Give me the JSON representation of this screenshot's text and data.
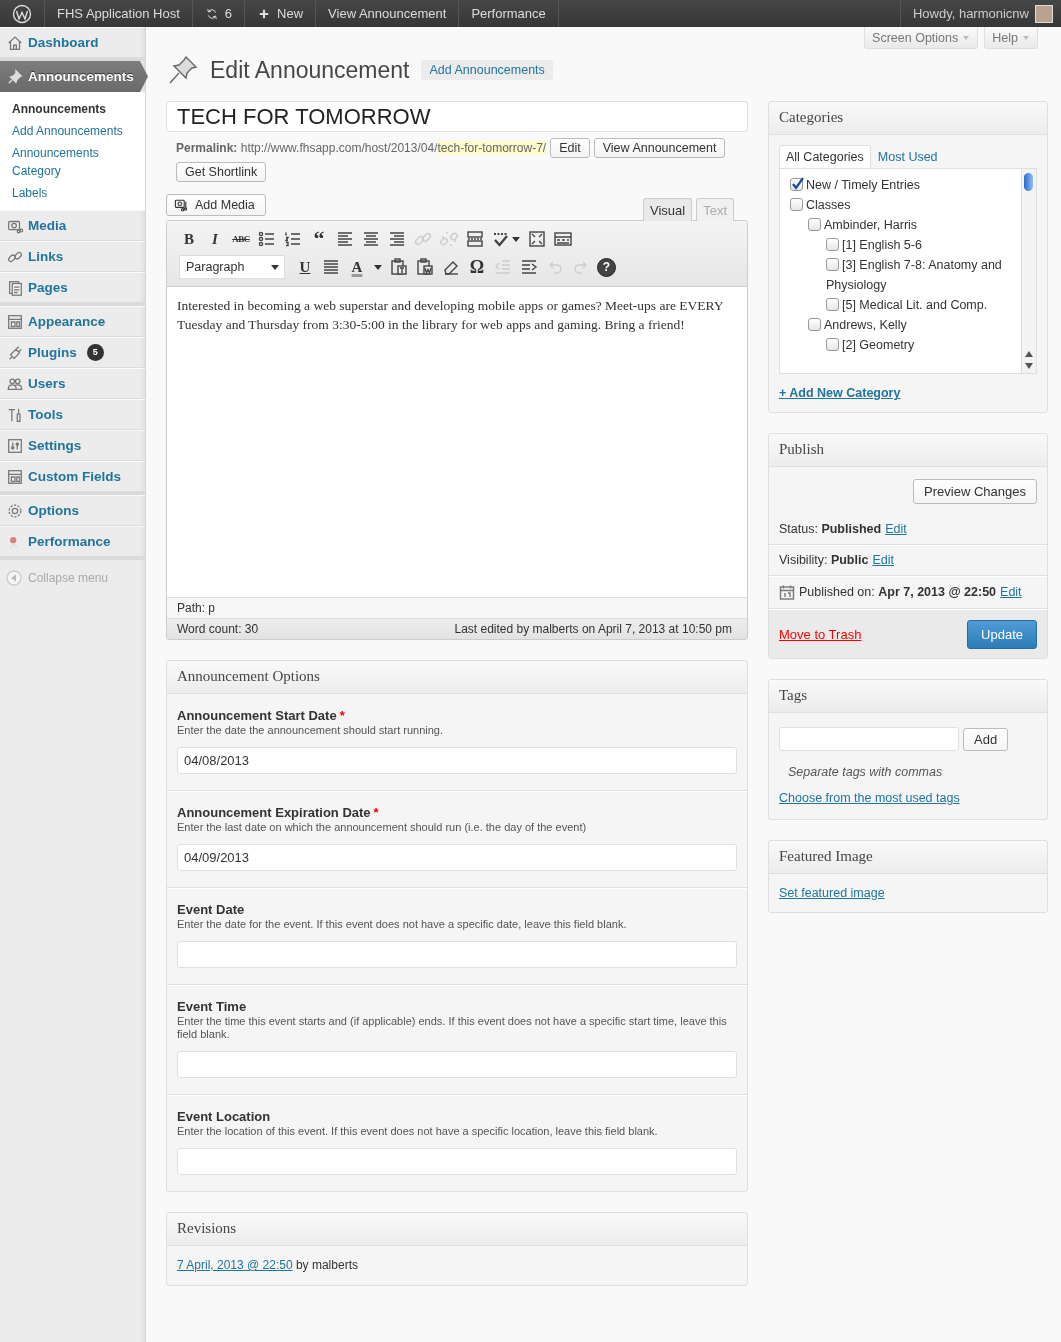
{
  "admin_bar": {
    "items": [
      {
        "kind": "logo"
      },
      {
        "kind": "text",
        "label": "FHS Application Host"
      },
      {
        "kind": "updates",
        "label": "6"
      },
      {
        "kind": "new",
        "label": "New"
      },
      {
        "kind": "text",
        "label": "View Announcement"
      },
      {
        "kind": "text",
        "label": "Performance"
      }
    ],
    "greeting": "Howdy, harmonicnw"
  },
  "admin_menu": {
    "groups": [
      [
        {
          "kind": "house",
          "label": "Dashboard",
          "selected": false
        }
      ],
      [
        {
          "kind": "pin",
          "label": "Announcements",
          "selected": true,
          "children": [
            {
              "label": "Announcements",
              "selected": true
            },
            {
              "label": "Add Announcements",
              "selected": false
            },
            {
              "label": "Announcements Category",
              "selected": false
            },
            {
              "label": "Labels",
              "selected": false
            }
          ]
        },
        {
          "kind": "media",
          "label": "Media",
          "selected": false
        },
        {
          "kind": "link",
          "label": "Links",
          "selected": false
        },
        {
          "kind": "pages",
          "label": "Pages",
          "selected": false
        }
      ],
      [
        {
          "kind": "appearance",
          "label": "Appearance",
          "selected": false
        },
        {
          "kind": "plug",
          "label": "Plugins",
          "selected": false,
          "badge": "5"
        },
        {
          "kind": "users",
          "label": "Users",
          "selected": false
        },
        {
          "kind": "tools",
          "label": "Tools",
          "selected": false
        },
        {
          "kind": "settings",
          "label": "Settings",
          "selected": false
        },
        {
          "kind": "fields",
          "label": "Custom Fields",
          "selected": false
        }
      ],
      [
        {
          "kind": "gear",
          "label": "Options",
          "selected": false
        },
        {
          "kind": "performance",
          "label": "Performance",
          "selected": false
        }
      ]
    ],
    "collapse": "Collapse menu"
  },
  "screen_meta": [
    "Screen Options",
    "Help"
  ],
  "heading": {
    "title": "Edit Announcement",
    "action": "Add Announcements"
  },
  "post_title": "TECH FOR TOMORROW",
  "permalink": {
    "label": "Permalink:",
    "base": "http://www.fhsapp.com/host/2013/04/",
    "slug": "tech-for-tomorrow-7/",
    "buttons": [
      "Edit",
      "View Announcement"
    ],
    "shortlink": "Get Shortlink"
  },
  "editor": {
    "add_media": "Add Media",
    "tabs": [
      {
        "label": "Visual",
        "selected": true
      },
      {
        "label": "Text",
        "selected": false
      }
    ],
    "toolbar_rows": [
      [
        {
          "kind": "bold",
          "text": "B",
          "disabled": false
        },
        {
          "kind": "italic",
          "text": "I",
          "disabled": false
        },
        {
          "kind": "strike",
          "text": "ABC",
          "disabled": false
        },
        {
          "kind": "bullets",
          "disabled": false
        },
        {
          "kind": "numbers",
          "disabled": false
        },
        {
          "kind": "quote",
          "text": "“",
          "disabled": false
        },
        {
          "kind": "align-left",
          "disabled": false
        },
        {
          "kind": "align-center",
          "disabled": false
        },
        {
          "kind": "align-right",
          "disabled": false
        },
        {
          "kind": "link",
          "disabled": true
        },
        {
          "kind": "unlink",
          "disabled": true
        },
        {
          "kind": "more",
          "disabled": false
        },
        {
          "kind": "spellcheck",
          "disabled": false
        },
        {
          "kind": "fullscreen",
          "disabled": false
        },
        {
          "kind": "kitchen-sink",
          "disabled": false
        }
      ],
      [
        {
          "kind": "select",
          "text": "Paragraph",
          "disabled": false
        },
        {
          "kind": "underline",
          "text": "U",
          "disabled": false
        },
        {
          "kind": "justify",
          "disabled": false
        },
        {
          "kind": "color",
          "text": "A",
          "disabled": false
        },
        {
          "kind": "paste-text",
          "disabled": false
        },
        {
          "kind": "paste-word",
          "disabled": false
        },
        {
          "kind": "eraser",
          "disabled": false
        },
        {
          "kind": "omega",
          "text": "Ω",
          "disabled": false
        },
        {
          "kind": "outdent",
          "disabled": true
        },
        {
          "kind": "indent",
          "disabled": false
        },
        {
          "kind": "undo",
          "disabled": true
        },
        {
          "kind": "redo",
          "disabled": true
        },
        {
          "kind": "help",
          "text": "?",
          "disabled": false
        }
      ]
    ],
    "content": "Interested in becoming a web superstar and developing mobile apps or games? Meet-ups are EVERY Tuesday and Thursday from 3:30-5:00 in the library for web apps and gaming. Bring a friend!",
    "path": "Path: p",
    "word_count": "Word count: 30",
    "last_edited": "Last edited by malberts on April 7, 2013 at 10:50 pm"
  },
  "options_box": {
    "title": "Announcement Options",
    "fields": [
      {
        "label": "Announcement Start Date",
        "required_mark": "*",
        "description": "Enter the date the announcement should start running.",
        "value": "04/08/2013"
      },
      {
        "label": "Announcement Expiration Date",
        "required_mark": "*",
        "description": "Enter the last date on which the announcement should run (i.e. the day of the event)",
        "value": "04/09/2013"
      },
      {
        "label": "Event Date",
        "description": "Enter the date for the event. If this event does not have a specific date, leave this field blank."
      },
      {
        "label": "Event Time",
        "description": "Enter the time this event starts and (if applicable) ends. If this event does not have a specific start time, leave this field blank."
      },
      {
        "label": "Event Location",
        "description": "Enter the location of this event. If this event does not have a specific location, leave this field blank."
      }
    ]
  },
  "revisions": {
    "title": "Revisions",
    "items": [
      {
        "date": "7 April, 2013 @ 22:50",
        "author": "by malberts"
      }
    ]
  },
  "categories": {
    "title": "Categories",
    "tabs": [
      {
        "label": "All Categories",
        "selected": true
      },
      {
        "label": "Most Used",
        "selected": false
      }
    ],
    "tree": [
      {
        "label": "New / Timely Entries",
        "checked": true
      },
      {
        "label": "Classes",
        "checked": false,
        "children": [
          {
            "label": "Ambinder, Harris",
            "checked": false,
            "children": [
              {
                "label": "[1] English 5-6",
                "checked": false
              },
              {
                "label": "[3] English 7-8: Anatomy and Physiology",
                "checked": false
              },
              {
                "label": "[5] Medical Lit. and Comp.",
                "checked": false
              }
            ]
          },
          {
            "label": "Andrews, Kelly",
            "checked": false,
            "children": [
              {
                "label": "[2] Geometry",
                "checked": false
              }
            ]
          }
        ]
      }
    ],
    "add_link": "+ Add New Category"
  },
  "publish": {
    "title": "Publish",
    "preview": "Preview Changes",
    "rows": [
      {
        "kind": "status",
        "label": "Status:",
        "value": "Published",
        "link": "Edit"
      },
      {
        "kind": "visibility",
        "label": "Visibility:",
        "value": "Public",
        "link": "Edit"
      },
      {
        "kind": "date",
        "label": "Published on:",
        "value": "Apr 7, 2013 @ 22:50",
        "link": "Edit"
      }
    ],
    "trash": "Move to Trash",
    "update": "Update"
  },
  "tags": {
    "title": "Tags",
    "button": "Add",
    "hint": "Separate tags with commas",
    "link": "Choose from the most used tags"
  },
  "featured_image": {
    "title": "Featured Image",
    "link": "Set featured image"
  }
}
